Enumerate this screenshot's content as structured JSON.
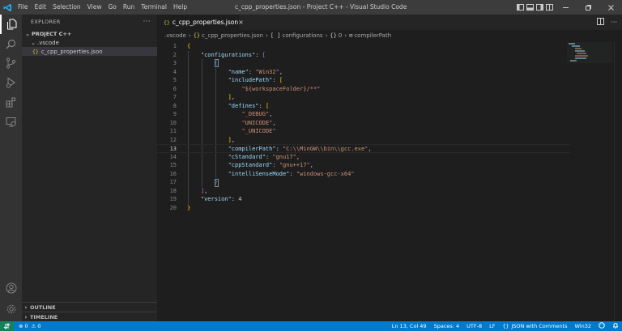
{
  "titlebar": {
    "menus": [
      "File",
      "Edit",
      "Selection",
      "View",
      "Go",
      "Run",
      "Terminal",
      "Help"
    ],
    "title": "c_cpp_properties.json - Project C++ - Visual Studio Code"
  },
  "activity": [
    "files-icon",
    "search-icon",
    "source-control-icon",
    "run-debug-icon",
    "extensions-icon",
    "remote-explorer-icon",
    "account-icon",
    "manage-gear-icon"
  ],
  "sidebar": {
    "header": "EXPLORER",
    "more": "···",
    "project": "PROJECT C++",
    "folder": ".vscode",
    "file": "c_cpp_properties.json",
    "file_glyph": "{}",
    "outline": "OUTLINE",
    "timeline": "TIMELINE"
  },
  "editor": {
    "tab_label": "c_cpp_properties.json",
    "tab_glyph": "{}",
    "tab_close": "×",
    "breadcrumb": [
      ".vscode",
      "c_cpp_properties.json",
      "configurations",
      "0",
      "compilerPath"
    ],
    "breadcrumb_glyphs": [
      "{}",
      "[ ]",
      "{}",
      "⊟"
    ],
    "lines": [
      [
        [
          "b1",
          "{"
        ]
      ],
      [
        [
          "p",
          "    "
        ],
        [
          "k",
          "\"configurations\""
        ],
        [
          "p",
          ": "
        ],
        [
          "b2",
          "["
        ]
      ],
      [
        [
          "p",
          "        "
        ],
        [
          "b3",
          "{"
        ]
      ],
      [
        [
          "p",
          "            "
        ],
        [
          "k",
          "\"name\""
        ],
        [
          "p",
          ": "
        ],
        [
          "s",
          "\"Win32\""
        ],
        [
          "p",
          ","
        ]
      ],
      [
        [
          "p",
          "            "
        ],
        [
          "k",
          "\"includePath\""
        ],
        [
          "p",
          ": "
        ],
        [
          "b1",
          "["
        ]
      ],
      [
        [
          "p",
          "                "
        ],
        [
          "s",
          "\"${workspaceFolder}/**\""
        ]
      ],
      [
        [
          "p",
          "            "
        ],
        [
          "b1",
          "]"
        ],
        [
          "p",
          ","
        ]
      ],
      [
        [
          "p",
          "            "
        ],
        [
          "k",
          "\"defines\""
        ],
        [
          "p",
          ": "
        ],
        [
          "b1",
          "["
        ]
      ],
      [
        [
          "p",
          "                "
        ],
        [
          "s",
          "\"_DEBUG\""
        ],
        [
          "p",
          ","
        ]
      ],
      [
        [
          "p",
          "                "
        ],
        [
          "s",
          "\"UNICODE\""
        ],
        [
          "p",
          ","
        ]
      ],
      [
        [
          "p",
          "                "
        ],
        [
          "s",
          "\"_UNICODE\""
        ]
      ],
      [
        [
          "p",
          "            "
        ],
        [
          "b1",
          "]"
        ],
        [
          "p",
          ","
        ]
      ],
      [
        [
          "p",
          "            "
        ],
        [
          "k",
          "\"compilerPath\""
        ],
        [
          "p",
          ": "
        ],
        [
          "s",
          "\"C:\\\\MinGW\\\\bin\\\\gcc.exe\""
        ],
        [
          "p",
          ","
        ]
      ],
      [
        [
          "p",
          "            "
        ],
        [
          "k",
          "\"cStandard\""
        ],
        [
          "p",
          ": "
        ],
        [
          "s",
          "\"gnu17\""
        ],
        [
          "p",
          ","
        ]
      ],
      [
        [
          "p",
          "            "
        ],
        [
          "k",
          "\"cppStandard\""
        ],
        [
          "p",
          ": "
        ],
        [
          "s",
          "\"gnu++17\""
        ],
        [
          "p",
          ","
        ]
      ],
      [
        [
          "p",
          "            "
        ],
        [
          "k",
          "\"intelliSenseMode\""
        ],
        [
          "p",
          ": "
        ],
        [
          "s",
          "\"windows-gcc-x64\""
        ]
      ],
      [
        [
          "p",
          "        "
        ],
        [
          "b3",
          "}"
        ]
      ],
      [
        [
          "p",
          "    "
        ],
        [
          "b2",
          "]"
        ],
        [
          "p",
          ","
        ]
      ],
      [
        [
          "p",
          "    "
        ],
        [
          "k",
          "\"version\""
        ],
        [
          "p",
          ": "
        ],
        [
          "n",
          "4"
        ]
      ],
      [
        [
          "b1",
          "}"
        ]
      ]
    ],
    "current_line": 13
  },
  "statusbar": {
    "errors": "0",
    "warnings": "0",
    "cursor": "Ln 13, Col 49",
    "spaces": "Spaces: 4",
    "encoding": "UTF-8",
    "eol": "LF",
    "language_glyph": "{}",
    "language": "JSON with Comments",
    "config": "Win32"
  },
  "colors": {
    "accent": "#007acc",
    "remote": "#16825d",
    "titlebar": "#3c3c3c",
    "sidebar": "#252526",
    "editor": "#1e1e1e"
  }
}
